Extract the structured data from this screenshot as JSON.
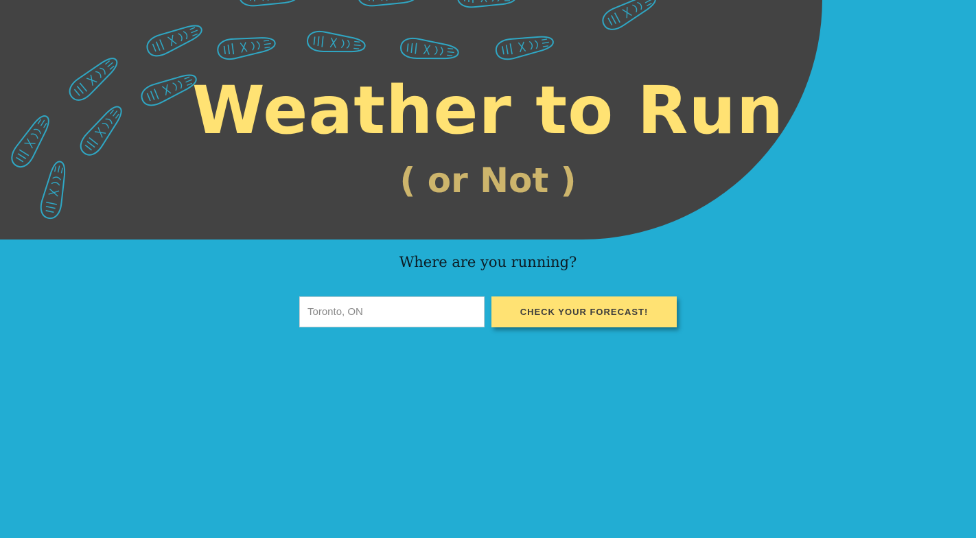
{
  "header": {
    "title": "Weather to Run",
    "subtitle": "( or Not )"
  },
  "search": {
    "prompt": "Where are you running?",
    "placeholder": "Toronto, ON",
    "value": "",
    "button_label": "CHECK YOUR FORECAST!"
  },
  "decor": {
    "footprint_icon": "footprint-icon"
  },
  "colors": {
    "background": "#22add3",
    "hero": "#434343",
    "title": "#ffe273",
    "subtitle": "#cdb56c",
    "button": "#ffe273",
    "footprint": "#2fa7c4"
  }
}
